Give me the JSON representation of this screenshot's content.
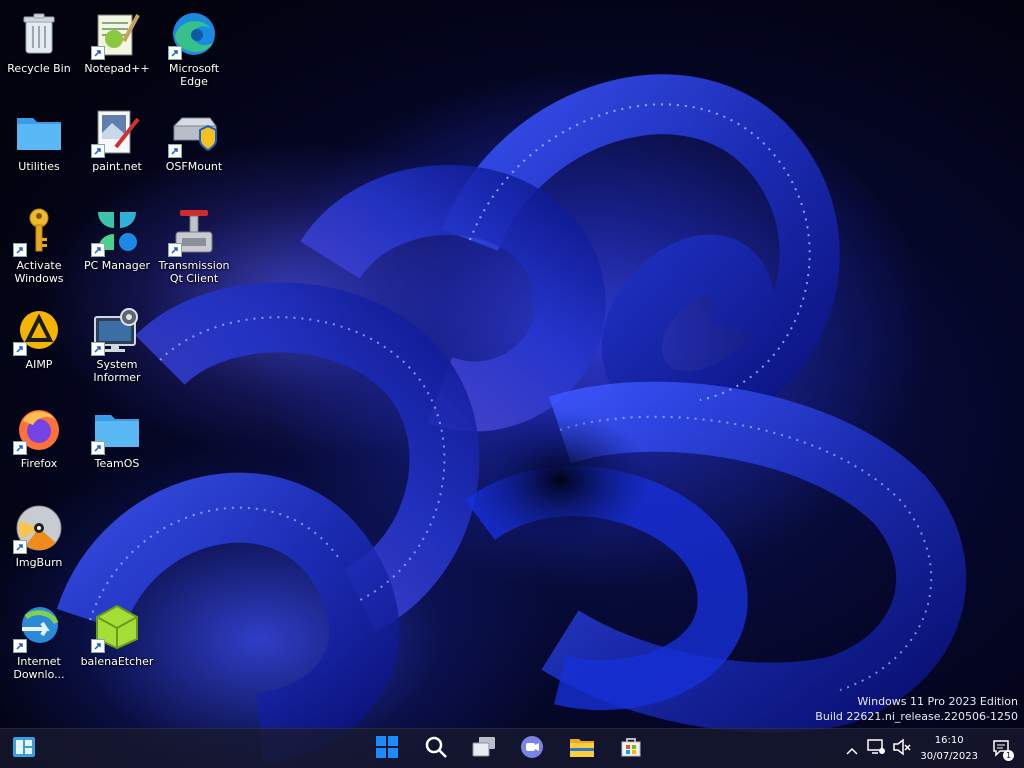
{
  "desktop": {
    "icons": [
      {
        "label": "Recycle Bin"
      },
      {
        "label": "Notepad++"
      },
      {
        "label": "Microsoft\nEdge"
      },
      {
        "label": "Utilities"
      },
      {
        "label": "paint.net"
      },
      {
        "label": "OSFMount"
      },
      {
        "label": "Activate\nWindows"
      },
      {
        "label": "PC Manager"
      },
      {
        "label": "Transmission\nQt Client"
      },
      {
        "label": "AIMP"
      },
      {
        "label": "System\nInformer"
      },
      {
        "label": "Firefox"
      },
      {
        "label": "TeamOS"
      },
      {
        "label": "ImgBurn"
      },
      {
        "label": "Internet\nDownlo..."
      },
      {
        "label": "balenaEtcher"
      }
    ]
  },
  "watermark": {
    "line1": "Windows 11 Pro 2023 Edition",
    "line2": "Build 22621.ni_release.220506-1250"
  },
  "taskbar": {
    "widgets_icon": "widgets-icon",
    "start_icon": "windows-start-icon",
    "search_icon": "search-icon",
    "task_view_icon": "task-view-icon",
    "chat_icon": "teams-chat-icon",
    "explorer_icon": "file-explorer-icon",
    "store_icon": "microsoft-store-icon"
  },
  "tray": {
    "time": "16:10",
    "date": "30/07/2023",
    "notification_count": "1"
  },
  "colors": {
    "accent": "#0078d4",
    "taskbar": "#181a30",
    "folder": "#4cb0f0"
  }
}
